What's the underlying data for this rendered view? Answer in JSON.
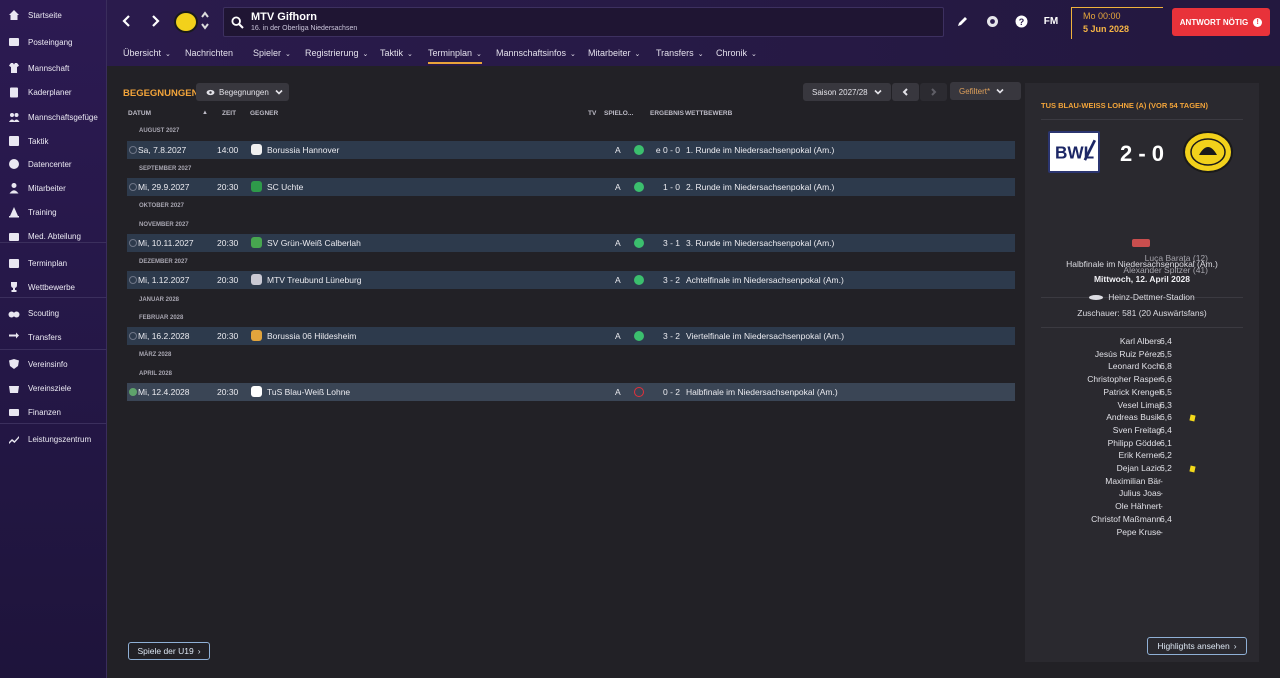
{
  "sidebar": {
    "items": [
      {
        "label": "Startseite",
        "icon": "home-icon"
      },
      {
        "label": "Posteingang",
        "icon": "inbox-icon"
      },
      {
        "label": "Mannschaft",
        "icon": "shirt-icon"
      },
      {
        "label": "Kaderplaner",
        "icon": "clipboard-icon"
      },
      {
        "label": "Mannschaftsgefüge",
        "icon": "people-icon"
      },
      {
        "label": "Taktik",
        "icon": "tactics-board-icon"
      },
      {
        "label": "Datencenter",
        "icon": "pie-icon"
      },
      {
        "label": "Mitarbeiter",
        "icon": "staff-icon"
      },
      {
        "label": "Training",
        "icon": "cone-icon"
      },
      {
        "label": "Med. Abteilung",
        "icon": "medical-icon"
      },
      {
        "label": "Terminplan",
        "icon": "calendar-icon"
      },
      {
        "label": "Wettbewerbe",
        "icon": "trophy-icon"
      },
      {
        "label": "Scouting",
        "icon": "binoculars-icon"
      },
      {
        "label": "Transfers",
        "icon": "transfer-icon"
      },
      {
        "label": "Vereinsinfo",
        "icon": "shield-icon"
      },
      {
        "label": "Vereinsziele",
        "icon": "target-icon"
      },
      {
        "label": "Finanzen",
        "icon": "money-icon"
      },
      {
        "label": "Leistungszentrum",
        "icon": "chart-up-icon"
      }
    ]
  },
  "header": {
    "club_name": "MTV Gifhorn",
    "club_sub": "16. in der Oberliga Niedersachsen",
    "fm_label": "FM",
    "time": "Mo 00:00",
    "date": "5 Jun 2028",
    "reply_label": "ANTWORT NÖTIG",
    "accent": "#e9a43a",
    "alert_color": "#e8323a"
  },
  "menu": [
    {
      "label": "Übersicht",
      "chevron": true
    },
    {
      "label": "Nachrichten",
      "chevron": false
    },
    {
      "label": "Spieler",
      "chevron": true
    },
    {
      "label": "Registrierung",
      "chevron": true
    },
    {
      "label": "Taktik",
      "chevron": true
    },
    {
      "label": "Terminplan",
      "chevron": true
    },
    {
      "label": "Mannschaftsinfos",
      "chevron": true
    },
    {
      "label": "Mitarbeiter",
      "chevron": true
    },
    {
      "label": "Transfers",
      "chevron": true
    },
    {
      "label": "Chronik",
      "chevron": true
    }
  ],
  "fixtures": {
    "title": "BEGEGNUNGEN",
    "view_dropdown": "Begegnungen",
    "season": "Saison 2027/28",
    "filter": "Gefiltert*",
    "columns": {
      "date": "DATUM",
      "time": "ZEIT",
      "opponent": "GEGNER",
      "tv": "TV",
      "venue": "SPIELO...",
      "result": "ERGEBNIS",
      "competition": "WETTBEWERB"
    },
    "months": [
      "AUGUST 2027",
      "SEPTEMBER 2027",
      "OKTOBER 2027",
      "NOVEMBER 2027",
      "DEZEMBER 2027",
      "JANUAR 2028",
      "FEBRUAR 2028",
      "MÄRZ 2028",
      "APRIL 2028"
    ],
    "matches": [
      {
        "date": "Sa, 7.8.2027",
        "time": "14:00",
        "opponent": "Borussia Hannover",
        "venue": "A",
        "outcome": "win",
        "result": "e 0 - 0",
        "competition": "1. Runde im Niedersachsenpokal (Am.)",
        "crest": "#f0f0f0"
      },
      {
        "date": "Mi, 29.9.2027",
        "time": "20:30",
        "opponent": "SC Uchte",
        "venue": "A",
        "outcome": "win",
        "result": "1 - 0",
        "competition": "2. Runde im Niedersachsenpokal (Am.)",
        "crest": "#2e9a4a"
      },
      {
        "date": "Mi, 10.11.2027",
        "time": "20:30",
        "opponent": "SV Grün-Weiß Calberlah",
        "venue": "A",
        "outcome": "win",
        "result": "3 - 1",
        "competition": "3. Runde im Niedersachsenpokal (Am.)",
        "crest": "#47a64f"
      },
      {
        "date": "Mi, 1.12.2027",
        "time": "20:30",
        "opponent": "MTV Treubund Lüneburg",
        "venue": "A",
        "outcome": "win",
        "result": "3 - 2",
        "competition": "Achtelfinale im Niedersachsenpokal (Am.)",
        "crest": "#c9c9d4"
      },
      {
        "date": "Mi, 16.2.2028",
        "time": "20:30",
        "opponent": "Borussia 06 Hildesheim",
        "venue": "A",
        "outcome": "win",
        "result": "3 - 2",
        "competition": "Viertelfinale im Niedersachsenpokal (Am.)",
        "crest": "#e2a43c"
      },
      {
        "date": "Mi, 12.4.2028",
        "time": "20:30",
        "opponent": "TuS Blau-Weiß Lohne",
        "venue": "A",
        "outcome": "loss",
        "result": "0 - 2",
        "competition": "Halbfinale im Niedersachsenpokal (Am.)",
        "crest": "#ffffff"
      }
    ],
    "u19_button": "Spiele der U19"
  },
  "match_panel": {
    "title": "TUS BLAU-WEISS LOHNE (A) (VOR 54 TAGEN)",
    "home_crest_text": "BWL",
    "score": "2 - 0",
    "scorers": [
      "Luca Barata (12)",
      "Alexander Spitzer (41)"
    ],
    "competition": "Halbfinale im Niedersachsenpokal (Am.)",
    "date": "Mittwoch, 12. April 2028",
    "stadium": "Heinz-Dettmer-Stadion",
    "attendance": "Zuschauer: 581 (20 Auswärtsfans)",
    "players": [
      {
        "name": "Karl Albers",
        "rating": "6,4",
        "card": false
      },
      {
        "name": "Jesús Ruiz Pérez",
        "rating": "6,5",
        "card": false
      },
      {
        "name": "Leonard Koch",
        "rating": "6,8",
        "card": false
      },
      {
        "name": "Christopher Rasper",
        "rating": "6,6",
        "card": false
      },
      {
        "name": "Patrick Krengel",
        "rating": "6,5",
        "card": false
      },
      {
        "name": "Vesel Limaj",
        "rating": "6,3",
        "card": false
      },
      {
        "name": "Andreas Busik",
        "rating": "6,6",
        "card": true
      },
      {
        "name": "Sven Freitag",
        "rating": "6,4",
        "card": false
      },
      {
        "name": "Philipp Gödde",
        "rating": "6,1",
        "card": false
      },
      {
        "name": "Erik Kerner",
        "rating": "6,2",
        "card": false
      },
      {
        "name": "Dejan Lazic",
        "rating": "6,2",
        "card": true
      },
      {
        "name": "Maximilian Bär",
        "rating": "-",
        "card": false
      },
      {
        "name": "Julius Joas",
        "rating": "-",
        "card": false
      },
      {
        "name": "Ole Hähnert",
        "rating": "-",
        "card": false
      },
      {
        "name": "Christof Maßmann",
        "rating": "6,4",
        "card": false
      },
      {
        "name": "Pepe Kruse",
        "rating": "-",
        "card": false
      }
    ],
    "highlights_button": "Highlights ansehen"
  }
}
